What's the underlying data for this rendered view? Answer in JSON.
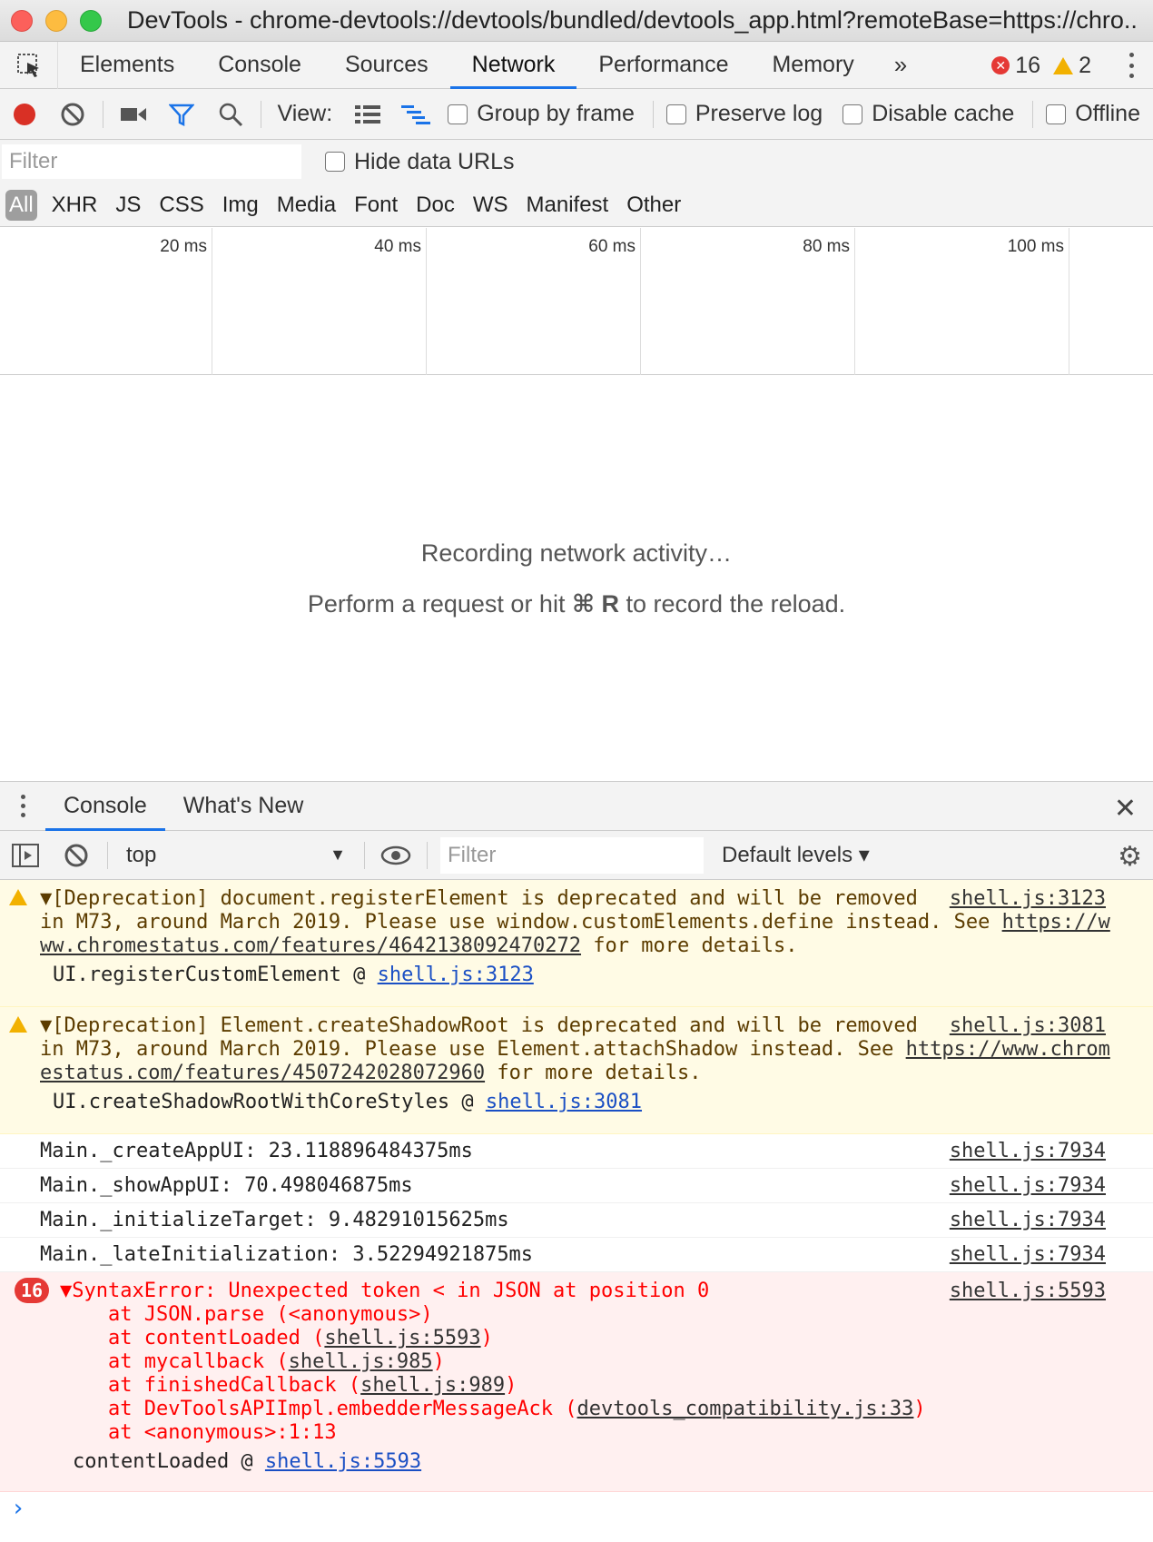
{
  "window": {
    "title": "DevTools - chrome-devtools://devtools/bundled/devtools_app.html?remoteBase=https://chro..."
  },
  "tabs": [
    "Elements",
    "Console",
    "Sources",
    "Network",
    "Performance",
    "Memory"
  ],
  "active_tab": "Network",
  "more_tabs": "»",
  "counts": {
    "errors": "16",
    "warnings": "2"
  },
  "network_toolbar": {
    "view_label": "View:",
    "group_by_frame": "Group by frame",
    "preserve_log": "Preserve log",
    "disable_cache": "Disable cache",
    "offline": "Offline"
  },
  "filter": {
    "placeholder": "Filter",
    "hide_data_urls": "Hide data URLs"
  },
  "types": [
    "All",
    "XHR",
    "JS",
    "CSS",
    "Img",
    "Media",
    "Font",
    "Doc",
    "WS",
    "Manifest",
    "Other"
  ],
  "timeline_ticks": [
    "20 ms",
    "40 ms",
    "60 ms",
    "80 ms",
    "100 ms"
  ],
  "empty": {
    "line1": "Recording network activity…",
    "line2_pre": "Perform a request or hit ",
    "line2_key": "⌘ R",
    "line2_post": " to record the reload."
  },
  "drawer": {
    "tabs": [
      "Console",
      "What's New"
    ],
    "context": "top",
    "filter_placeholder": "Filter",
    "levels": "Default levels ▾"
  },
  "console": {
    "warn1": {
      "lines": [
        "▼[Deprecation] document.registerElement is deprecated and will be removed",
        "in M73, around March 2019. Please use window.customElements.define instead. See ",
        " for more details."
      ],
      "link_a": "https://w",
      "link_b": "ww.chromestatus.com/features/4642138092470272",
      "src": "shell.js:3123",
      "trace_fn": "UI.registerCustomElement @ ",
      "trace_src": "shell.js:3123"
    },
    "warn2": {
      "lines": [
        "▼[Deprecation] Element.createShadowRoot is deprecated and will be removed",
        "in M73, around March 2019. Please use Element.attachShadow instead. See ",
        " for more details."
      ],
      "link_a": "https://www.chrom",
      "link_b": "estatus.com/features/4507242028072960",
      "src": "shell.js:3081",
      "trace_fn": "UI.createShadowRootWithCoreStyles @ ",
      "trace_src": "shell.js:3081"
    },
    "logs": [
      {
        "text": "Main._createAppUI: 23.118896484375ms",
        "src": "shell.js:7934"
      },
      {
        "text": "Main._showAppUI: 70.498046875ms",
        "src": "shell.js:7934"
      },
      {
        "text": "Main._initializeTarget: 9.48291015625ms",
        "src": "shell.js:7934"
      },
      {
        "text": "Main._lateInitialization: 3.52294921875ms",
        "src": "shell.js:7934"
      }
    ],
    "error": {
      "count": "16",
      "head": "▼SyntaxError: Unexpected token < in JSON at position 0",
      "src": "shell.js:5593",
      "s1": "    at JSON.parse (<anonymous>)",
      "s2a": "    at contentLoaded (",
      "s2b": "shell.js:5593",
      "s2c": ")",
      "s3a": "    at mycallback (",
      "s3b": "shell.js:985",
      "s3c": ")",
      "s4a": "    at finishedCallback (",
      "s4b": "shell.js:989",
      "s4c": ")",
      "s5a": "    at DevToolsAPIImpl.embedderMessageAck (",
      "s5b": "devtools_compatibility.js:33",
      "s5c": ")",
      "s6": "    at <anonymous>:1:13",
      "trace_fn": "contentLoaded @ ",
      "trace_src": "shell.js:5593"
    },
    "prompt": "›"
  }
}
